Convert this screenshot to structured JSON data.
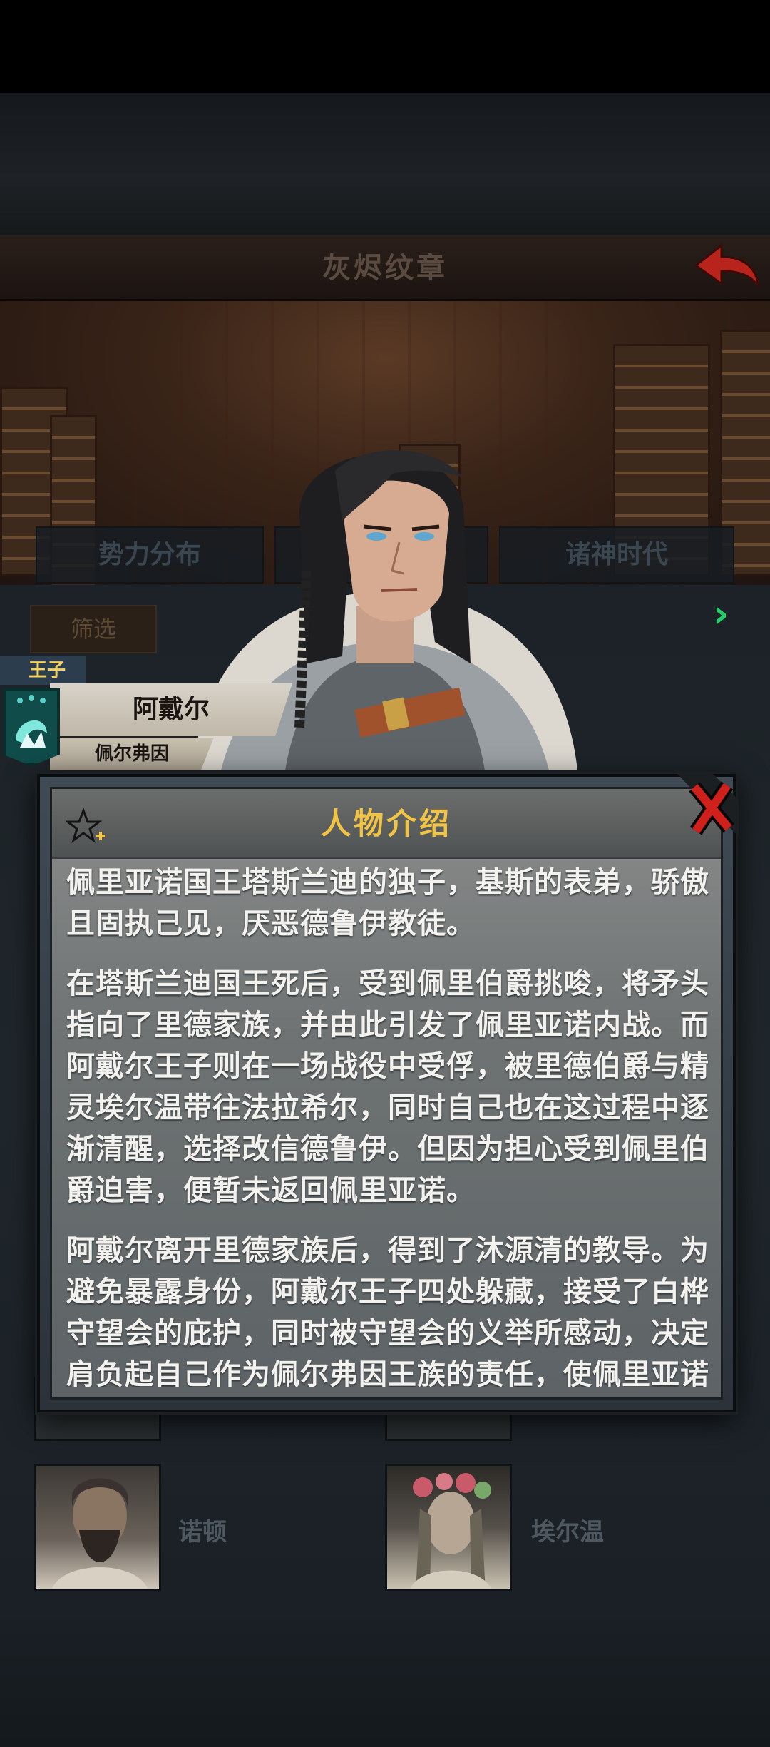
{
  "header": {
    "title": "灰烬纹章"
  },
  "tabs": [
    {
      "label": "势力分布"
    },
    {
      "label": ""
    },
    {
      "label": "诸神时代"
    }
  ],
  "filter": {
    "label": "筛选"
  },
  "character": {
    "rank": "王子",
    "name": "阿戴尔",
    "house": "佩尔弗因"
  },
  "cards": [
    {
      "name": "诺顿"
    },
    {
      "name": "埃尔温"
    }
  ],
  "modal": {
    "title": "人物介绍",
    "paragraphs": [
      "佩里亚诺国王塔斯兰迪的独子，基斯的表弟，骄傲且固执己见，厌恶德鲁伊教徒。",
      "在塔斯兰迪国王死后，受到佩里伯爵挑唆，将矛头指向了里德家族，并由此引发了佩里亚诺内战。而阿戴尔王子则在一场战役中受俘，被里德伯爵与精灵埃尔温带往法拉希尔，同时自己也在这过程中逐渐清醒，选择改信德鲁伊。但因为担心受到佩里伯爵迫害，便暂未返回佩里亚诺。",
      "阿戴尔离开里德家族后，得到了沐源清的教导。为避免暴露身份，阿戴尔王子四处躲藏，接受了白桦守望会的庇护，同时被守望会的义举所感动，决定肩负起自己作为佩尔弗因王族的责任，使佩里亚诺"
    ]
  },
  "colors": {
    "modal_title": "#f1c446",
    "rank_tag": "#f3d35a",
    "next_arrow": "#23d06a",
    "close_x": "#d0201c",
    "back_arrow": "#b8241c"
  },
  "icons": {
    "back": "back-arrow-icon",
    "close": "close-x-icon",
    "star": "star-plus-icon",
    "next": "chevron-right-icon",
    "crest": "house-crest-icon"
  }
}
